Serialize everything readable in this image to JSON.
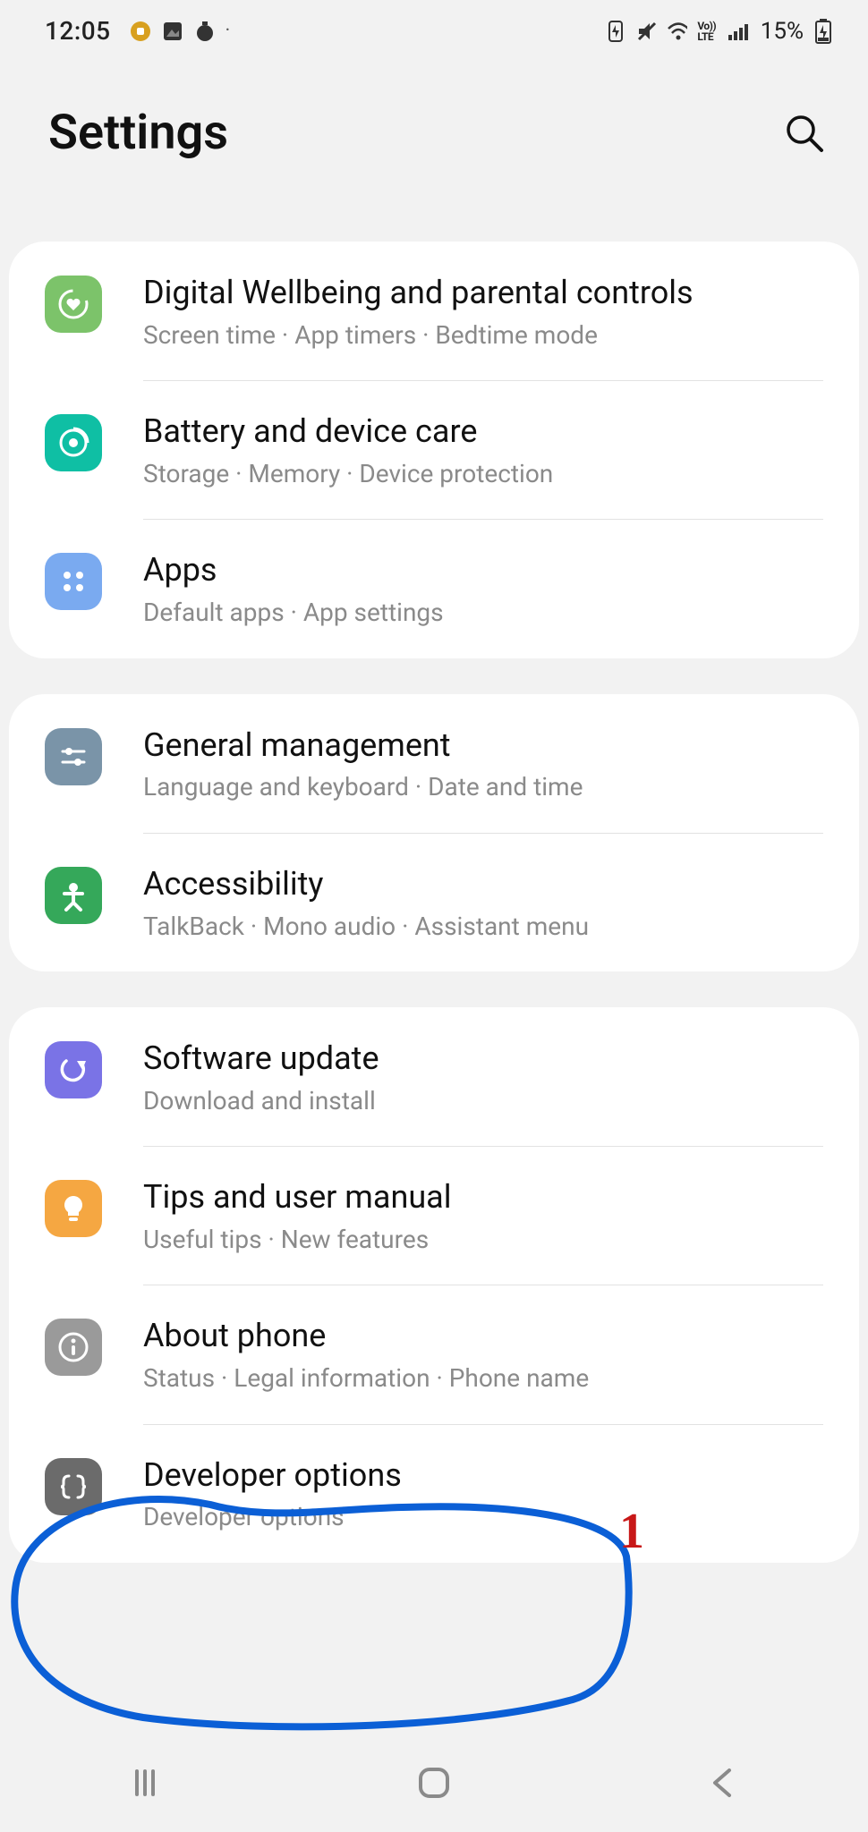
{
  "status": {
    "time": "12:05",
    "battery_pct": "15%"
  },
  "header": {
    "title": "Settings"
  },
  "groups": [
    {
      "items": [
        {
          "key": "digital-wellbeing",
          "title": "Digital Wellbeing and parental controls",
          "sub": "Screen time  ·  App timers  ·  Bedtime mode",
          "icon": "heart-ring-icon",
          "color": "ic-green"
        },
        {
          "key": "battery-device-care",
          "title": "Battery and device care",
          "sub": "Storage  ·  Memory  ·  Device protection",
          "icon": "ring-target-icon",
          "color": "ic-teal"
        },
        {
          "key": "apps",
          "title": "Apps",
          "sub": "Default apps  ·  App settings",
          "icon": "dots-grid-icon",
          "color": "ic-blue"
        }
      ]
    },
    {
      "items": [
        {
          "key": "general-management",
          "title": "General management",
          "sub": "Language and keyboard  ·  Date and time",
          "icon": "sliders-icon",
          "color": "ic-slate"
        },
        {
          "key": "accessibility",
          "title": "Accessibility",
          "sub": "TalkBack  ·  Mono audio  ·  Assistant menu",
          "icon": "person-icon",
          "color": "ic-dgreen"
        }
      ]
    },
    {
      "items": [
        {
          "key": "software-update",
          "title": "Software update",
          "sub": "Download and install",
          "icon": "refresh-icon",
          "color": "ic-purple"
        },
        {
          "key": "tips-manual",
          "title": "Tips and user manual",
          "sub": "Useful tips  ·  New features",
          "icon": "bulb-icon",
          "color": "ic-orange"
        },
        {
          "key": "about-phone",
          "title": "About phone",
          "sub": "Status  ·  Legal information  ·  Phone name",
          "icon": "info-icon",
          "color": "ic-gray"
        },
        {
          "key": "developer-options",
          "title": "Developer options",
          "sub": "Developer options",
          "icon": "braces-icon",
          "color": "ic-dgray"
        }
      ]
    }
  ],
  "annotation": {
    "label": "1"
  }
}
